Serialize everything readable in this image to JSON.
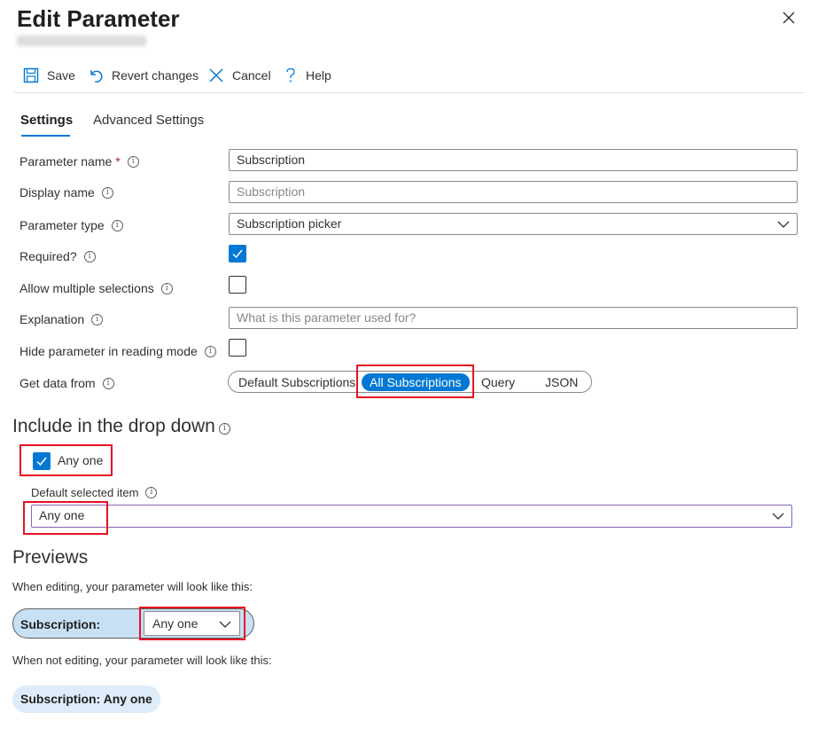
{
  "header": {
    "title": "Edit Parameter"
  },
  "toolbar": {
    "save_label": "Save",
    "revert_label": "Revert changes",
    "cancel_label": "Cancel",
    "help_label": "Help"
  },
  "tabs": [
    {
      "label": "Settings",
      "active": true
    },
    {
      "label": "Advanced Settings",
      "active": false
    }
  ],
  "form": {
    "parameter_name": {
      "label": "Parameter name",
      "required_mark": "*",
      "value": "Subscription"
    },
    "display_name": {
      "label": "Display name",
      "placeholder": "Subscription"
    },
    "parameter_type": {
      "label": "Parameter type",
      "value": "Subscription picker"
    },
    "required": {
      "label": "Required?",
      "checked": true
    },
    "allow_multiple": {
      "label": "Allow multiple selections",
      "checked": false
    },
    "explanation": {
      "label": "Explanation",
      "placeholder": "What is this parameter used for?"
    },
    "hide_in_reading": {
      "label": "Hide parameter in reading mode",
      "checked": false
    },
    "get_data_from": {
      "label": "Get data from",
      "options": [
        "Default Subscriptions",
        "All Subscriptions",
        "Query",
        "JSON"
      ],
      "selected": "All Subscriptions"
    }
  },
  "include_dropdown": {
    "heading": "Include in the drop down",
    "any_one_label": "Any one",
    "any_one_checked": true,
    "default_selected_label": "Default selected item",
    "default_selected_value": "Any one"
  },
  "previews": {
    "heading": "Previews",
    "editing_caption": "When editing, your parameter will look like this:",
    "editing_label": "Subscription:",
    "editing_value": "Any one",
    "not_editing_caption": "When not editing, your parameter will look like this:",
    "not_editing_text": "Subscription: Any one"
  },
  "colors": {
    "accent": "#0078d4",
    "highlight_box": "#e81123",
    "preview_editing_bg": "#c7e0f4",
    "preview_static_bg": "#deecf9"
  }
}
